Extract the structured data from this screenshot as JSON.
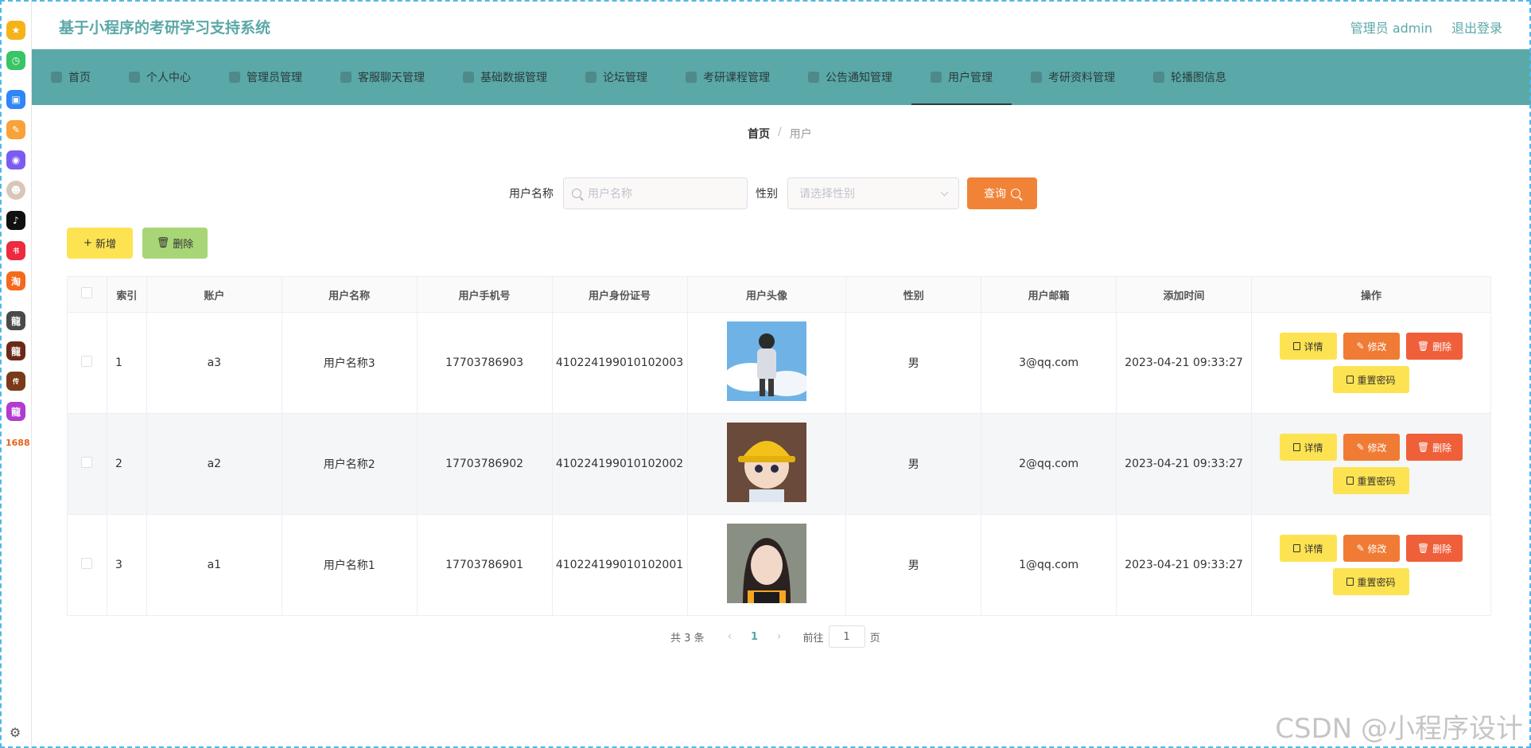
{
  "header": {
    "title": "基于小程序的考研学习支持系统",
    "user": "管理员 admin",
    "logout": "退出登录"
  },
  "nav": [
    {
      "label": "首页",
      "icon": "home-icon"
    },
    {
      "label": "个人中心",
      "icon": "user-icon"
    },
    {
      "label": "管理员管理",
      "icon": "admin-icon"
    },
    {
      "label": "客服聊天管理",
      "icon": "chat-icon"
    },
    {
      "label": "基础数据管理",
      "icon": "database-icon"
    },
    {
      "label": "论坛管理",
      "icon": "forum-icon"
    },
    {
      "label": "考研课程管理",
      "icon": "course-icon"
    },
    {
      "label": "公告通知管理",
      "icon": "notice-icon"
    },
    {
      "label": "用户管理",
      "icon": "users-icon",
      "active": true
    },
    {
      "label": "考研资料管理",
      "icon": "document-icon"
    },
    {
      "label": "轮播图信息",
      "icon": "carousel-icon"
    }
  ],
  "breadcrumb": {
    "home": "首页",
    "separator": "/",
    "current": "用户"
  },
  "search": {
    "name_label": "用户名称",
    "name_placeholder": "用户名称",
    "gender_label": "性别",
    "gender_placeholder": "请选择性别",
    "query_button": "查询"
  },
  "actions": {
    "add": "新增",
    "delete": "删除"
  },
  "table": {
    "headers": [
      "索引",
      "账户",
      "用户名称",
      "用户手机号",
      "用户身份证号",
      "用户头像",
      "性别",
      "用户邮箱",
      "添加时间",
      "操作"
    ],
    "rows": [
      {
        "index": "1",
        "account": "a3",
        "name": "用户名称3",
        "phone": "17703786903",
        "id_card": "410224199010102003",
        "gender": "男",
        "email": "3@qq.com",
        "time": "2023-04-21 09:33:27"
      },
      {
        "index": "2",
        "account": "a2",
        "name": "用户名称2",
        "phone": "17703786902",
        "id_card": "410224199010102002",
        "gender": "男",
        "email": "2@qq.com",
        "time": "2023-04-21 09:33:27"
      },
      {
        "index": "3",
        "account": "a1",
        "name": "用户名称1",
        "phone": "17703786901",
        "id_card": "410224199010102001",
        "gender": "男",
        "email": "1@qq.com",
        "time": "2023-04-21 09:33:27"
      }
    ],
    "ops": {
      "detail": "详情",
      "edit": "修改",
      "delete": "删除",
      "reset": "重置密码"
    }
  },
  "pagination": {
    "total": "共 3 条",
    "prev": "‹",
    "page": "1",
    "next": "›",
    "goto": "前往",
    "goto_value": "1",
    "unit": "页"
  },
  "dock": {
    "text_item": "1688"
  },
  "watermark": "CSDN @小程序设计"
}
